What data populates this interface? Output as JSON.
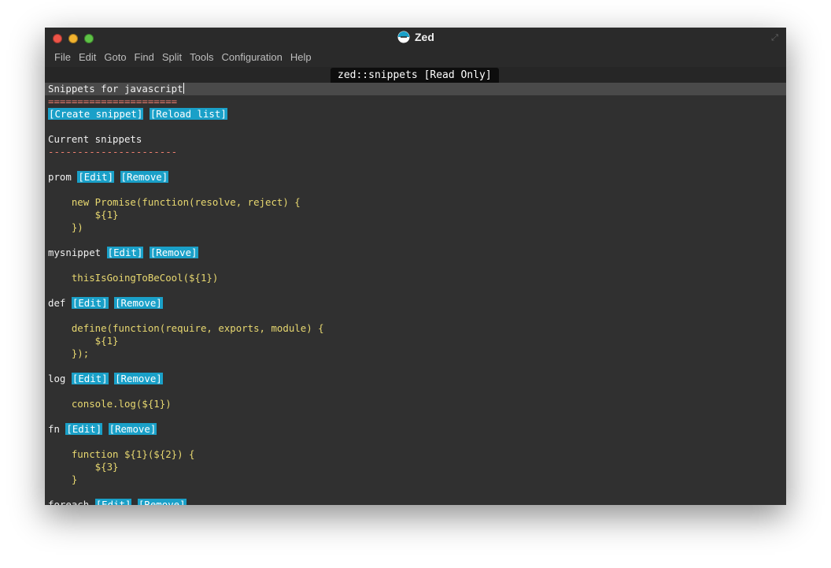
{
  "app": {
    "title": "Zed",
    "colors": {
      "window_bg": "#303030",
      "code": "#e8d870",
      "link_bg": "#1aa0c8",
      "rule": "#f08070"
    }
  },
  "menu": [
    "File",
    "Edit",
    "Goto",
    "Find",
    "Split",
    "Tools",
    "Configuration",
    "Help"
  ],
  "tab": {
    "label": "zed::snippets [Read Only]"
  },
  "doc": {
    "heading": "Snippets for javascript",
    "heading_rule": "======================",
    "create_label": "[Create snippet]",
    "reload_label": "[Reload list]",
    "subheading": "Current snippets",
    "sub_rule": "----------------------",
    "edit_label": "[Edit]",
    "remove_label": "[Remove]",
    "snippets": [
      {
        "name": "prom",
        "code": [
          "    new Promise(function(resolve, reject) {",
          "        ${1}",
          "    })"
        ]
      },
      {
        "name": "mysnippet",
        "code": [
          "    thisIsGoingToBeCool(${1})"
        ]
      },
      {
        "name": "def",
        "code": [
          "    define(function(require, exports, module) {",
          "        ${1}",
          "    });"
        ]
      },
      {
        "name": "log",
        "code": [
          "    console.log(${1})"
        ]
      },
      {
        "name": "fn",
        "code": [
          "    function ${1}(${2}) {",
          "        ${3}",
          "    }"
        ]
      },
      {
        "name": "foreach",
        "code": []
      }
    ]
  }
}
